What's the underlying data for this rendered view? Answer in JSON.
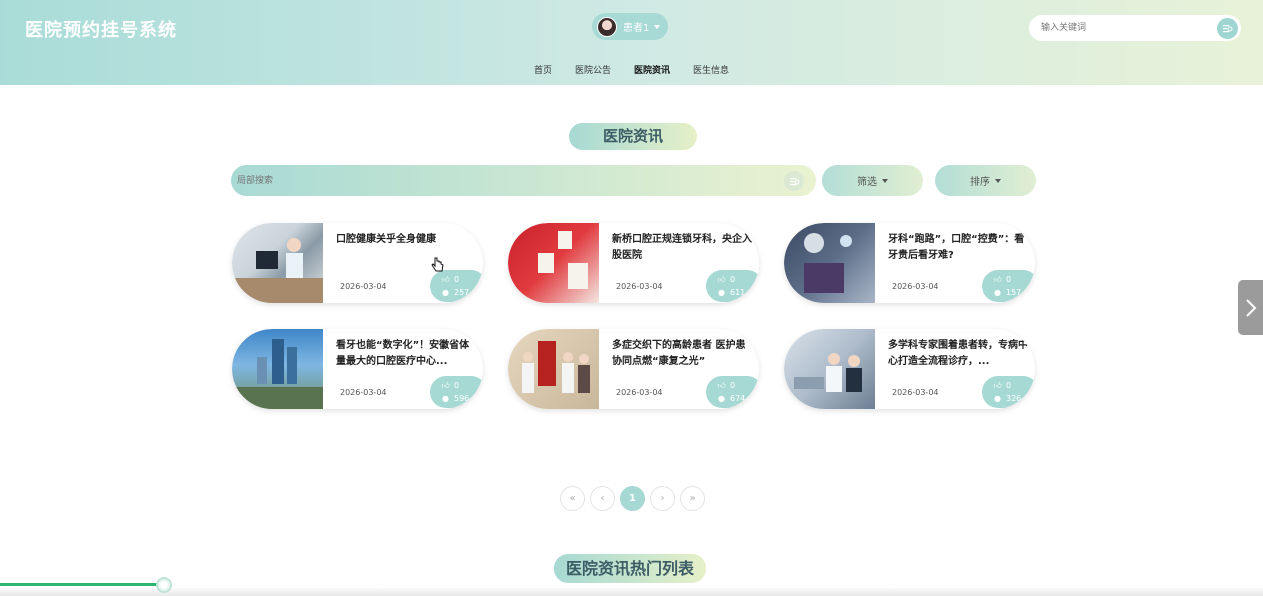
{
  "header": {
    "site_title": "医院预约挂号系统",
    "user_name": "患者1",
    "search_placeholder": "输入关键词"
  },
  "nav": [
    {
      "label": "首页",
      "active": false
    },
    {
      "label": "医院公告",
      "active": false
    },
    {
      "label": "医院资讯",
      "active": true
    },
    {
      "label": "医生信息",
      "active": false
    }
  ],
  "section_title": "医院资讯",
  "filters": {
    "local_search_placeholder": "局部搜索",
    "filter_label": "筛选",
    "sort_label": "排序"
  },
  "cards": [
    {
      "title": "口腔健康关乎全身健康",
      "date": "2026-03-04",
      "likes": "0",
      "views": "257"
    },
    {
      "title": "新桥口腔正规连锁牙科，央企入股医院",
      "date": "2026-03-04",
      "likes": "0",
      "views": "611"
    },
    {
      "title": "牙科“跑路”，口腔“控费”：看牙贵后看牙难?",
      "date": "2026-03-04",
      "likes": "0",
      "views": "157"
    },
    {
      "title": "看牙也能“数字化”！安徽省体量最大的口腔医疗中心...",
      "date": "2026-03-04",
      "likes": "0",
      "views": "596"
    },
    {
      "title": "多症交织下的高龄患者 医护患协同点燃“康复之光”",
      "date": "2026-03-04",
      "likes": "0",
      "views": "674"
    },
    {
      "title": "多学科专家围着患者转，专病中心打造全流程诊疗，...",
      "date": "2026-03-04",
      "likes": "0",
      "views": "326"
    }
  ],
  "pagination": {
    "first": "«",
    "prev": "‹",
    "current": "1",
    "next": "›",
    "last": "»"
  },
  "hot_title": "医院资讯热门列表",
  "progress": 0.13,
  "colors": {
    "accent": "#a6d9d3",
    "progress": "#2bb673"
  }
}
